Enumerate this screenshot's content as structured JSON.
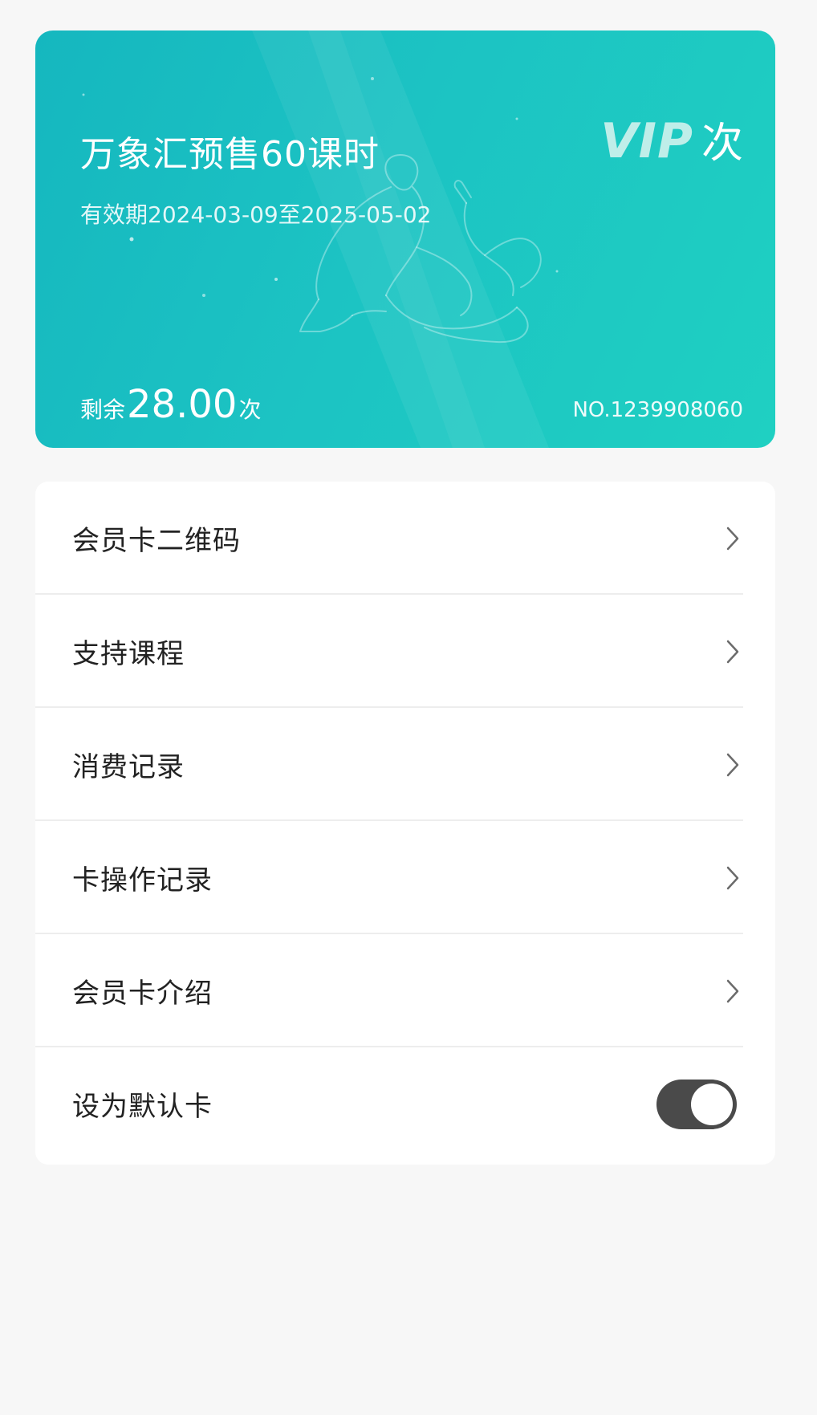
{
  "card": {
    "title": "万象汇预售60课时",
    "validity": "有效期2024-03-09至2025-05-02",
    "badge_vip": "VIP",
    "badge_unit": "次",
    "balance_label": "剩余",
    "balance_value": "28.00",
    "balance_unit": "次",
    "card_number": "NO.1239908060",
    "colors": {
      "gradient_start": "#15b7bf",
      "gradient_end": "#1fd0c2"
    },
    "illustration": "yoga-pose-outline"
  },
  "menu": {
    "items": [
      {
        "label": "会员卡二维码",
        "icon": "chevron-right-icon"
      },
      {
        "label": "支持课程",
        "icon": "chevron-right-icon"
      },
      {
        "label": "消费记录",
        "icon": "chevron-right-icon"
      },
      {
        "label": "卡操作记录",
        "icon": "chevron-right-icon"
      },
      {
        "label": "会员卡介绍",
        "icon": "chevron-right-icon"
      }
    ],
    "default_card": {
      "label": "设为默认卡",
      "enabled": true
    }
  }
}
